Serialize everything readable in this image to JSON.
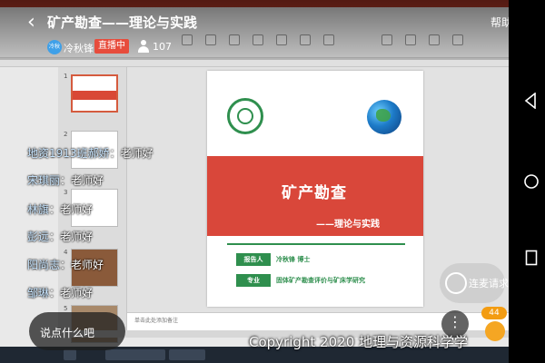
{
  "header": {
    "title": "矿产勘查——理论与实践",
    "help_label": "帮助",
    "host_avatar_text": "冷秋",
    "host_name": "冷秋锋",
    "live_badge": "直播中",
    "viewer_count": "107"
  },
  "slide": {
    "title": "矿产勘查",
    "subtitle": "——理论与实践",
    "rows": [
      {
        "tag": "报告人",
        "value": "冷秋锋   博士"
      },
      {
        "tag": "专业",
        "value": "固体矿产勘查评价与矿床学研究"
      }
    ],
    "notes_placeholder": "单击此处添加备注"
  },
  "chat": [
    {
      "name": "地资1913班郝娇",
      "text": "老师好"
    },
    {
      "name": "宋琪丽",
      "text": "老师好"
    },
    {
      "name": "林旗",
      "text": "老师好"
    },
    {
      "name": "彭远",
      "text": "老师好"
    },
    {
      "name": "阳尚志",
      "text": "老师好"
    },
    {
      "name": "邹琳",
      "text": "老师好"
    }
  ],
  "chat_input_placeholder": "说点什么吧",
  "link_request_label": "连麦请求",
  "like_count": "44",
  "copyright": "Copyright 2020 地理与资源科学学",
  "colors": {
    "live_badge": "#e74c3c",
    "slide_band": "#d9473a",
    "slide_accent": "#2f8f4e",
    "like_badge": "#f39c12"
  }
}
